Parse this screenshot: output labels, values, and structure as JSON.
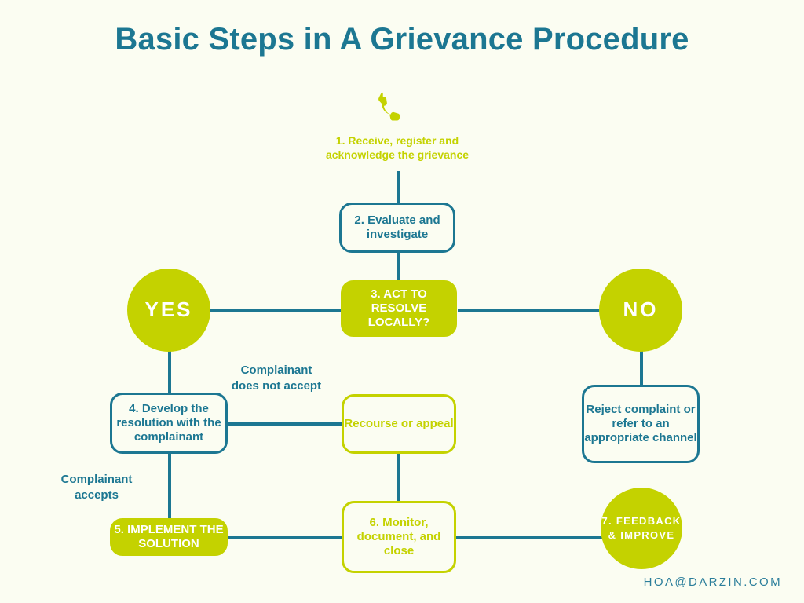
{
  "page": {
    "title": "Basic Steps in A Grievance Procedure",
    "background_color": "#fbfdf2",
    "teal": "#1c7792",
    "lime": "#c4d200",
    "white": "#ffffff"
  },
  "footer": {
    "email": "HOA@DARZIN.COM"
  },
  "icons": {
    "phone": "phone-icon"
  },
  "nodes": {
    "step1": {
      "id": "step-1",
      "label": "1. Receive, register and acknowledge the grievance",
      "style": "text-only-lime"
    },
    "step2": {
      "id": "step-2",
      "label": "2. Evaluate and investigate",
      "style": "teal-outline-box"
    },
    "step3": {
      "id": "step-3",
      "label": "3. ACT TO RESOLVE LOCALLY?",
      "style": "lime-filled-box"
    },
    "yes": {
      "id": "decision-yes",
      "label": "YES",
      "style": "lime-circle"
    },
    "no": {
      "id": "decision-no",
      "label": "NO",
      "style": "lime-circle"
    },
    "step4": {
      "id": "step-4",
      "label": "4. Develop the resolution with the complainant",
      "style": "teal-outline-box"
    },
    "recourse": {
      "id": "recourse-or-appeal",
      "label": "Recourse or appeal",
      "style": "lime-outline-box"
    },
    "reject": {
      "id": "reject-complaint",
      "label": "Reject complaint or refer to an appropriate channel",
      "style": "teal-outline-box"
    },
    "step5": {
      "id": "step-5",
      "label": "5. IMPLEMENT THE SOLUTION",
      "style": "lime-filled-box"
    },
    "step6": {
      "id": "step-6",
      "label": "6. Monitor, document, and close",
      "style": "lime-outline-box"
    },
    "step7": {
      "id": "step-7",
      "label": "7. FEEDBACK & IMPROVE",
      "style": "lime-circle"
    }
  },
  "edge_labels": {
    "does_not_accept": "Complainant does not accept",
    "accepts": "Complainant accepts"
  }
}
